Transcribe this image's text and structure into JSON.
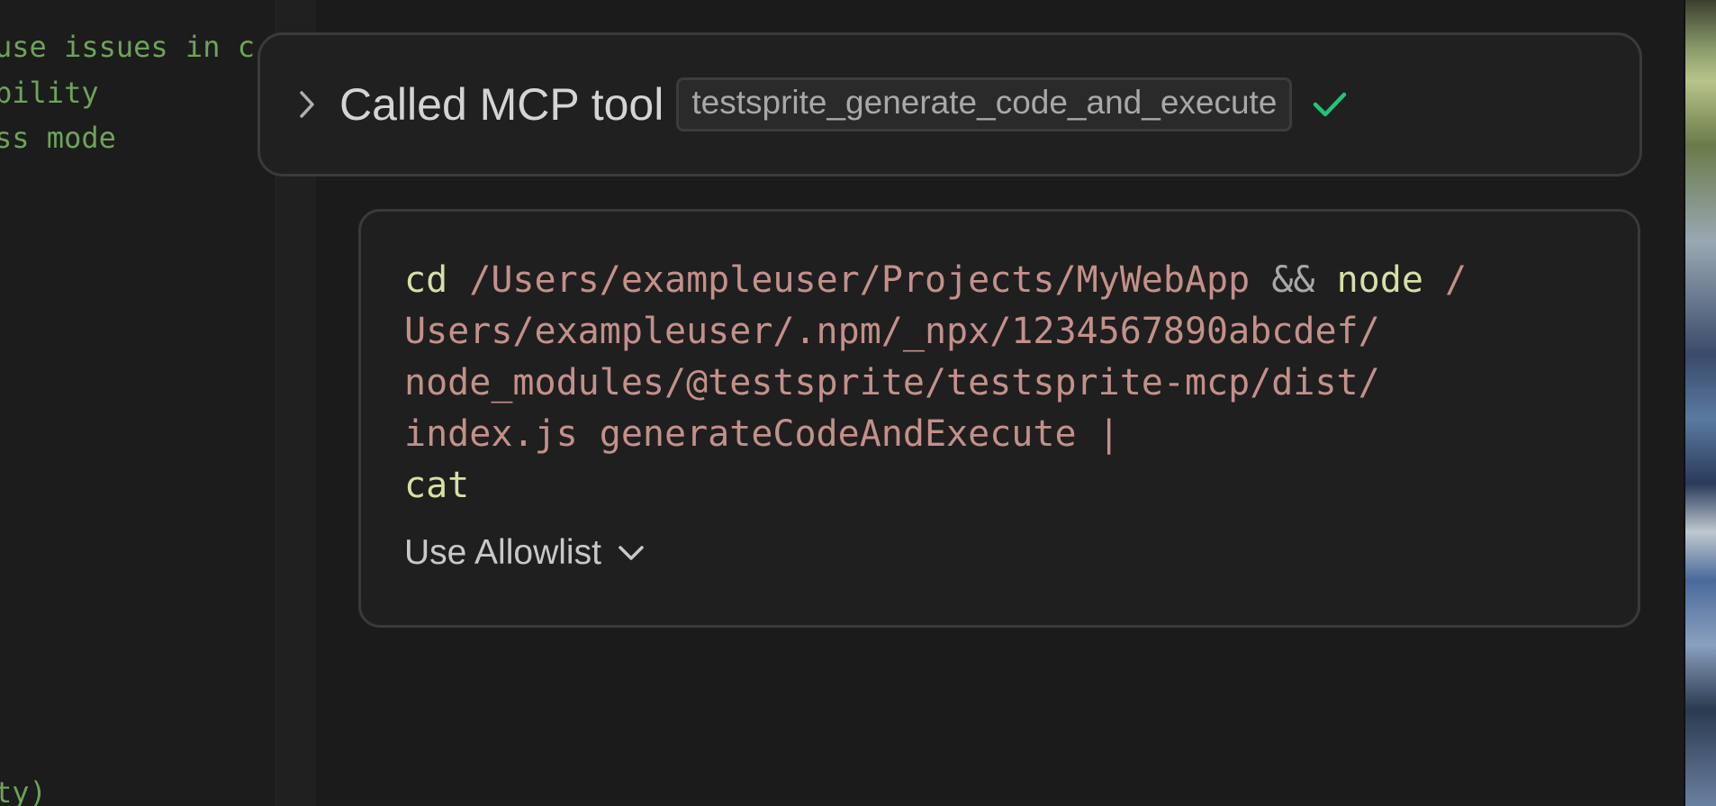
{
  "editor": {
    "lines": [
      "use issues in c",
      "bility",
      "ss mode",
      "ty)"
    ]
  },
  "tool_call": {
    "title": "Called MCP tool",
    "tool_name": "testsprite_generate_code_and_execute",
    "status": "success",
    "status_color": "#22c47a"
  },
  "command": {
    "line1_cmd": "cd",
    "line1_path": "/Users/exampleuser/Projects/MyWebApp",
    "line1_op": "&&",
    "line1_cmd2": "node",
    "line1_path2": "/",
    "line2": "Users/exampleuser/.npm/_npx/1234567890abcdef/",
    "line3": "node_modules/@testsprite/testsprite-mcp/dist/",
    "line4": "index.js generateCodeAndExecute |",
    "line5": "cat"
  },
  "allowlist": {
    "label": "Use Allowlist"
  },
  "colors": {
    "command_color": "#d7dfa6",
    "path_color": "#c4908a",
    "editor_text": "#6ea35a"
  }
}
